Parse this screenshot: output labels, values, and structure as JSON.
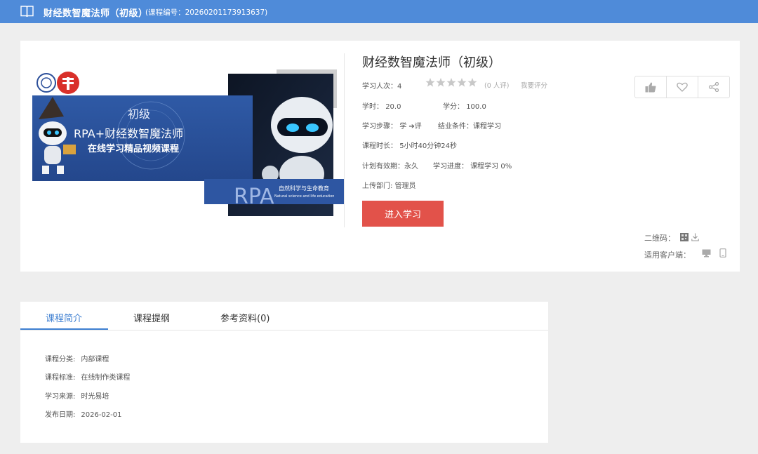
{
  "header": {
    "title": "财经数智魔法师（初级）",
    "course_code": "(课程编号：20260201173913637)"
  },
  "course": {
    "title": "财经数智魔法师（初级）",
    "learners_label": "学习人次：",
    "learners_value": "4",
    "rating": 0,
    "rating_count": "(0 人评)",
    "rate_link": "我要评分",
    "hours_label": "学时：",
    "hours_value": "20.0",
    "credits_label": "学分：",
    "credits_value": "100.0",
    "steps_label": "学习步骤：",
    "steps_value": "学 ➔评",
    "completion_label": "结业条件：",
    "completion_value": "课程学习",
    "duration_label": "课程时长：",
    "duration_value": "5小时40分钟24秒",
    "validity_label": "计划有效期：",
    "validity_value": "永久",
    "progress_label": "学习进度：",
    "progress_value": "课程学习  0%",
    "department_label": "上传部门:",
    "department_value": "管理员",
    "enter_button": "进入学习",
    "qr_label": "二维码：",
    "client_label": "适用客户端："
  },
  "cover": {
    "level": "初级",
    "banner_title": "RPA+财经数智魔法师",
    "banner_subtitle": "在线学习精品视频课程",
    "rpa": "RPA",
    "caption_cn": "自然科学与生命教育",
    "caption_en": "Natural science and life education"
  },
  "tabs": [
    {
      "label": "课程简介"
    },
    {
      "label": "课程提纲"
    },
    {
      "label": "参考资料(0)"
    }
  ],
  "details": [
    {
      "label": "课程分类:",
      "value": "内部课程"
    },
    {
      "label": "课程标准:",
      "value": "在线制作类课程"
    },
    {
      "label": "学习来源:",
      "value": "时光易培"
    },
    {
      "label": "发布日期:",
      "value": "2026-02-01"
    }
  ],
  "colors": {
    "header": "#4f8bd9",
    "accent": "#3e7fd1",
    "button": "#e2524a"
  }
}
